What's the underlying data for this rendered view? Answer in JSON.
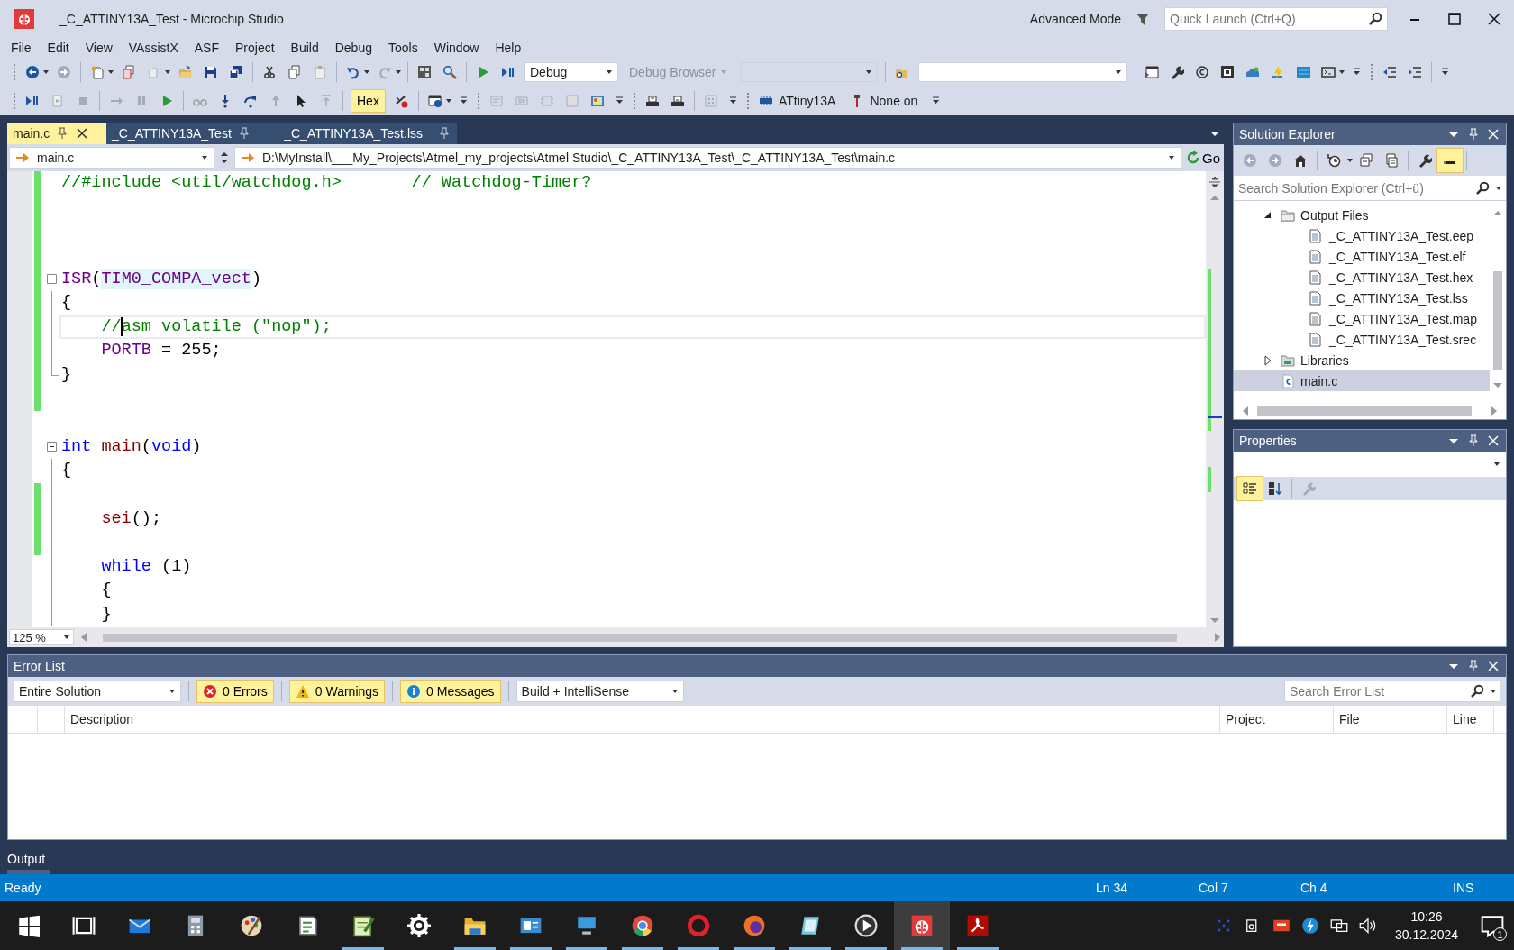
{
  "window": {
    "title": "_C_ATTINY13A_Test - Microchip Studio",
    "mode": "Advanced Mode",
    "quick_launch": {
      "placeholder": "Quick Launch (Ctrl+Q)"
    }
  },
  "menu": [
    "File",
    "Edit",
    "View",
    "VAssistX",
    "ASF",
    "Project",
    "Build",
    "Debug",
    "Tools",
    "Window",
    "Help"
  ],
  "toolbar": {
    "configuration": "Debug",
    "debug_browser": "Debug Browser",
    "hex": {
      "label": "Hex",
      "selected": true
    },
    "device": "ATtiny13A",
    "tool": "None on"
  },
  "editor_tabs": [
    {
      "label": "main.c",
      "selected": true
    },
    {
      "label": "_C_ATTINY13A_Test",
      "selected": false
    },
    {
      "label": "_C_ATTINY13A_Test.lss",
      "selected": false
    }
  ],
  "navigation": {
    "file": "main.c",
    "path": "D:\\MyInstall\\___My_Projects\\Atmel_my_projects\\Atmel Studio\\_C_ATTINY13A_Test\\_C_ATTINY13A_Test\\main.c",
    "go": "Go"
  },
  "code_lines": [
    {
      "changed": true,
      "current": false,
      "collapsible": false,
      "block_end": false,
      "tokens": [
        {
          "kind": "comment",
          "text": "//#include <util/watchdog.h>       // Watchdog-Timer?"
        }
      ]
    },
    {
      "changed": true,
      "current": false,
      "collapsible": false,
      "block_end": false
    },
    {
      "changed": true,
      "current": false,
      "collapsible": false,
      "block_end": false
    },
    {
      "changed": true,
      "current": false,
      "collapsible": false,
      "block_end": false
    },
    {
      "changed": true,
      "current": false,
      "collapsible": true,
      "block_end": false,
      "tokens": [
        {
          "kind": "macro",
          "text": "ISR"
        },
        {
          "kind": "plain",
          "text": "("
        },
        {
          "kind": "reference",
          "text": "TIM0_COMPA_vect"
        },
        {
          "kind": "plain",
          "text": ")"
        }
      ]
    },
    {
      "changed": true,
      "current": false,
      "collapsible": false,
      "block_end": false,
      "tokens": [
        {
          "kind": "plain",
          "text": "{"
        }
      ]
    },
    {
      "changed": true,
      "current": true,
      "collapsible": false,
      "block_end": false,
      "tokens": [
        {
          "kind": "indent"
        },
        {
          "kind": "comment",
          "text": "//"
        },
        {
          "kind": "caret"
        },
        {
          "kind": "comment",
          "text": "asm volatile (\"nop\");"
        }
      ]
    },
    {
      "changed": true,
      "current": false,
      "collapsible": false,
      "block_end": false,
      "tokens": [
        {
          "kind": "indent"
        },
        {
          "kind": "macro",
          "text": "PORTB"
        },
        {
          "kind": "plain",
          "text": " = 255;"
        }
      ]
    },
    {
      "changed": true,
      "current": false,
      "collapsible": false,
      "block_end": true,
      "tokens": [
        {
          "kind": "plain",
          "text": "}"
        }
      ]
    },
    {
      "changed": true,
      "current": false,
      "collapsible": false,
      "block_end": false
    },
    {
      "changed": false,
      "current": false,
      "collapsible": false,
      "block_end": false
    },
    {
      "changed": false,
      "current": false,
      "collapsible": true,
      "block_end": false,
      "tokens": [
        {
          "kind": "keyword",
          "text": "int"
        },
        {
          "kind": "space"
        },
        {
          "kind": "function",
          "text": "main"
        },
        {
          "kind": "plain",
          "text": "("
        },
        {
          "kind": "keyword",
          "text": "void"
        },
        {
          "kind": "plain",
          "text": ")"
        }
      ]
    },
    {
      "changed": false,
      "current": false,
      "collapsible": false,
      "block_end": false,
      "tokens": [
        {
          "kind": "plain",
          "text": "{"
        }
      ]
    },
    {
      "changed": true,
      "current": false,
      "collapsible": false,
      "block_end": false
    },
    {
      "changed": true,
      "current": false,
      "collapsible": false,
      "block_end": false,
      "tokens": [
        {
          "kind": "indent"
        },
        {
          "kind": "function",
          "text": "sei"
        },
        {
          "kind": "plain",
          "text": "();"
        }
      ]
    },
    {
      "changed": true,
      "current": false,
      "collapsible": false,
      "block_end": false
    },
    {
      "changed": false,
      "current": false,
      "collapsible": false,
      "block_end": false,
      "tokens": [
        {
          "kind": "indent"
        },
        {
          "kind": "keyword",
          "text": "while"
        },
        {
          "kind": "plain",
          "text": " (1)"
        }
      ]
    },
    {
      "changed": false,
      "current": false,
      "collapsible": false,
      "block_end": false,
      "tokens": [
        {
          "kind": "indent"
        },
        {
          "kind": "plain",
          "text": "{"
        }
      ]
    },
    {
      "changed": false,
      "current": false,
      "collapsible": false,
      "block_end": false,
      "tokens": [
        {
          "kind": "indent"
        },
        {
          "kind": "plain",
          "text": "}"
        }
      ]
    }
  ],
  "zoom": "125 %",
  "solution_explorer": {
    "title": "Solution Explorer",
    "search": {
      "placeholder": "Search Solution Explorer (Ctrl+ü)"
    },
    "tree": [
      {
        "label": "Output Files",
        "kind": "folder",
        "expanded": true,
        "selected": false,
        "children": [
          {
            "label": "_C_ATTINY13A_Test.eep",
            "kind": "file",
            "selected": false
          },
          {
            "label": "_C_ATTINY13A_Test.elf",
            "kind": "file",
            "selected": false
          },
          {
            "label": "_C_ATTINY13A_Test.hex",
            "kind": "file",
            "selected": false
          },
          {
            "label": "_C_ATTINY13A_Test.lss",
            "kind": "file",
            "selected": false
          },
          {
            "label": "_C_ATTINY13A_Test.map",
            "kind": "file",
            "selected": false
          },
          {
            "label": "_C_ATTINY13A_Test.srec",
            "kind": "file",
            "selected": false
          }
        ]
      },
      {
        "label": "Libraries",
        "kind": "library",
        "expanded": false,
        "selected": false
      },
      {
        "label": "main.c",
        "kind": "source",
        "selected": true
      }
    ]
  },
  "properties": {
    "title": "Properties"
  },
  "error_list": {
    "title": "Error List",
    "scope": "Entire Solution",
    "filters": [
      {
        "kind": "error",
        "label": "0 Errors",
        "selected": true
      },
      {
        "kind": "warning",
        "label": "0 Warnings",
        "selected": true
      },
      {
        "kind": "info",
        "label": "0 Messages",
        "selected": true
      }
    ],
    "source": "Build + IntelliSense",
    "search": {
      "placeholder": "Search Error List"
    },
    "columns": [
      "Description",
      "Project",
      "File",
      "Line"
    ]
  },
  "output_tab": "Output",
  "status_bar": {
    "state": "Ready",
    "line": "Ln 34",
    "column": "Col 7",
    "char": "Ch 4",
    "mode": "INS"
  },
  "taskbar": {
    "apps": [
      {
        "kind": "start",
        "running": false,
        "active": false
      },
      {
        "kind": "taskview",
        "running": false,
        "active": false
      },
      {
        "kind": "mail",
        "running": false,
        "active": false
      },
      {
        "kind": "calculator",
        "running": false,
        "active": false
      },
      {
        "kind": "paint",
        "running": false,
        "active": false
      },
      {
        "kind": "script",
        "running": false,
        "active": false
      },
      {
        "kind": "notepad",
        "running": true,
        "active": false
      },
      {
        "kind": "settings",
        "running": false,
        "active": false
      },
      {
        "kind": "explorer",
        "running": true,
        "active": false
      },
      {
        "kind": "contacts",
        "running": true,
        "active": false
      },
      {
        "kind": "computer",
        "running": true,
        "active": false
      },
      {
        "kind": "chrome",
        "running": true,
        "active": false
      },
      {
        "kind": "opera",
        "running": true,
        "active": false
      },
      {
        "kind": "firefox",
        "running": true,
        "active": false
      },
      {
        "kind": "book",
        "running": true,
        "active": false
      },
      {
        "kind": "player",
        "running": true,
        "active": false
      },
      {
        "kind": "studio",
        "running": true,
        "active": true
      },
      {
        "kind": "pdf",
        "running": true,
        "active": false
      }
    ],
    "time": "10:26",
    "date": "30.12.2024",
    "notifications": "1"
  }
}
